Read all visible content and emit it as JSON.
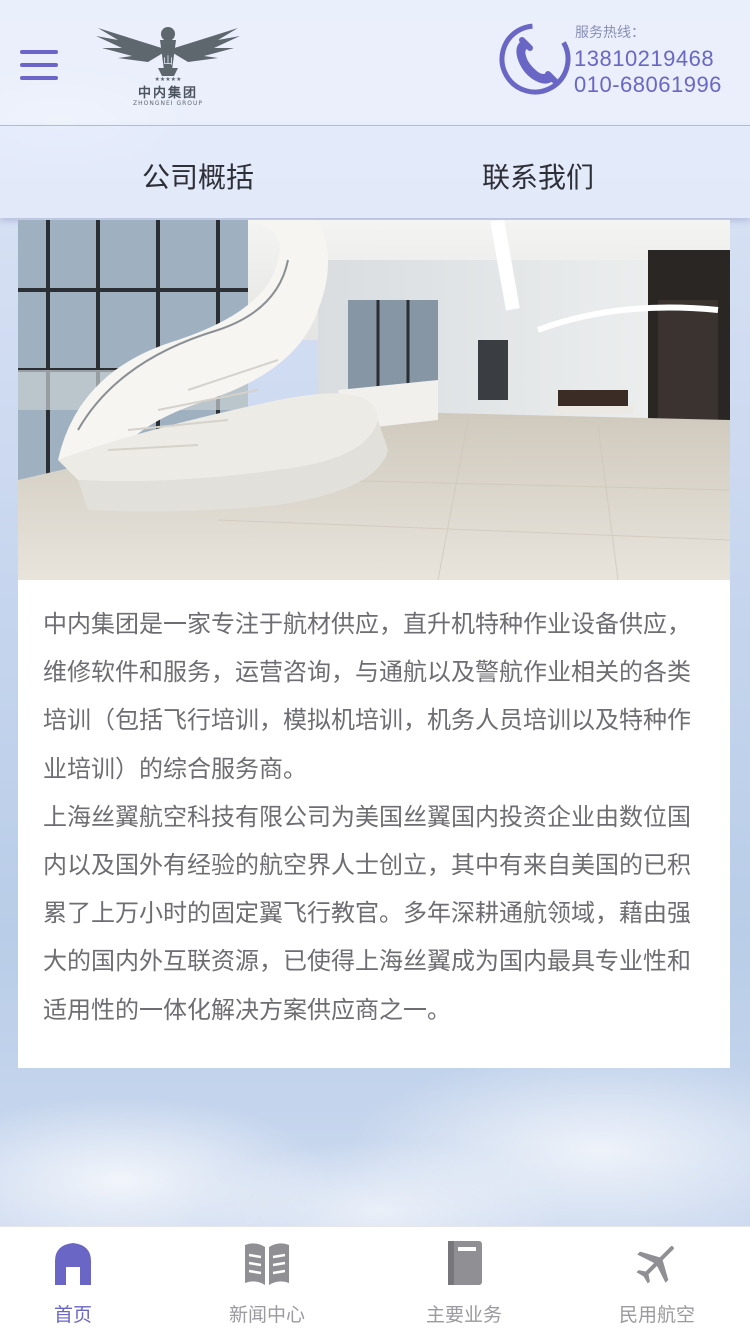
{
  "header": {
    "logo_text": "中内集团",
    "logo_sub": "ZHONGNEI GROUP",
    "hotline_label": "服务热线：",
    "phone_1": "13810219468",
    "phone_2": "010-68061996"
  },
  "nav": {
    "items": [
      {
        "label": "公司概括"
      },
      {
        "label": "联系我们"
      }
    ]
  },
  "content": {
    "paragraph_1": "中内集团是一家专注于航材供应，直升机特种作业设备供应，维修软件和服务，运营咨询，与通航以及警航作业相关的各类培训（包括飞行培训，模拟机培训，机务人员培训以及特种作业培训）的综合服务商。",
    "paragraph_2": "上海丝翼航空科技有限公司为美国丝翼国内投资企业由数位国内以及国外有经验的航空界人士创立，其中有来自美国的已积累了上万小时的固定翼飞行教官。多年深耕通航领域，藉由强大的国内外互联资源，已使得上海丝翼成为国内最具专业性和适用性的一体化解决方案供应商之一。"
  },
  "tabbar": {
    "items": [
      {
        "label": "首页",
        "icon": "home-icon",
        "active": true
      },
      {
        "label": "新闻中心",
        "icon": "news-icon",
        "active": false
      },
      {
        "label": "主要业务",
        "icon": "book-icon",
        "active": false
      },
      {
        "label": "民用航空",
        "icon": "airplane-icon",
        "active": false
      }
    ]
  },
  "colors": {
    "accent": "#6a66c5",
    "inactive": "#9a9a9f",
    "text": "#6e6e72"
  }
}
